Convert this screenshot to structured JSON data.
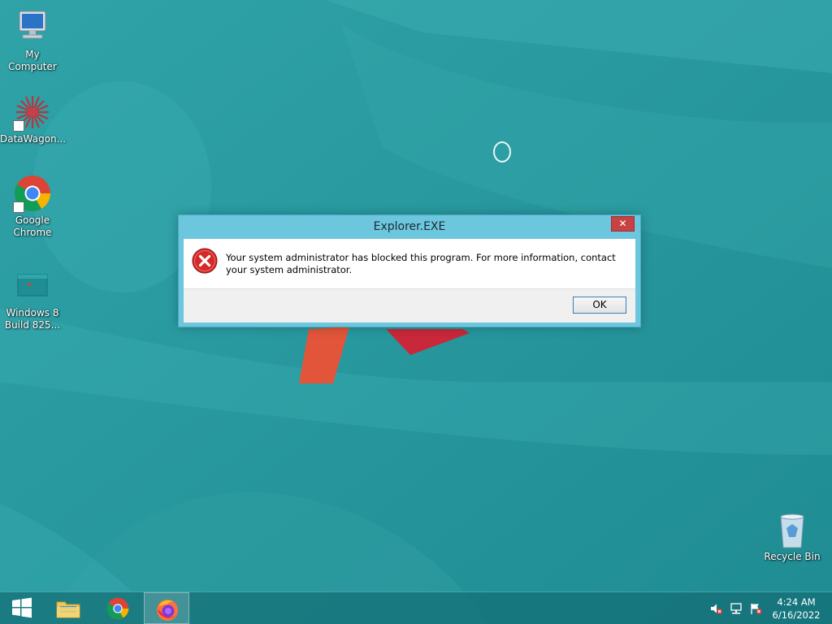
{
  "desktop": {
    "icons": [
      {
        "label": "My Computer",
        "icon": "computer-icon"
      },
      {
        "label": "DataWagon...",
        "icon": "datawagon-icon"
      },
      {
        "label": "Google\nChrome",
        "icon": "chrome-icon"
      },
      {
        "label": "Windows 8\nBuild 825...",
        "icon": "document-icon"
      }
    ],
    "recycle_bin": {
      "label": "Recycle Bin",
      "icon": "recycle-bin-icon"
    }
  },
  "dialog": {
    "title": "Explorer.EXE",
    "close_glyph": "✕",
    "message": "Your system administrator has blocked this program. For more information, contact your system administrator.",
    "ok_label": "OK",
    "icon": "error-icon"
  },
  "taskbar": {
    "start_icon": "windows-start-icon",
    "pinned": [
      {
        "name": "File Explorer",
        "icon": "folder-icon"
      },
      {
        "name": "Google Chrome",
        "icon": "chrome-icon"
      },
      {
        "name": "Firefox",
        "icon": "firefox-icon",
        "active": true
      }
    ],
    "tray": [
      {
        "icon": "volume-muted-icon"
      },
      {
        "icon": "network-icon"
      },
      {
        "icon": "action-center-flag-icon"
      }
    ],
    "clock": {
      "time": "4:24 AM",
      "date": "6/16/2022"
    }
  },
  "colors": {
    "desktop_bg": "#2a9aa0",
    "dialog_frame": "#6cc6dd",
    "close_button": "#c74343",
    "error_red": "#d42a2a",
    "taskbar": "#146e74"
  }
}
